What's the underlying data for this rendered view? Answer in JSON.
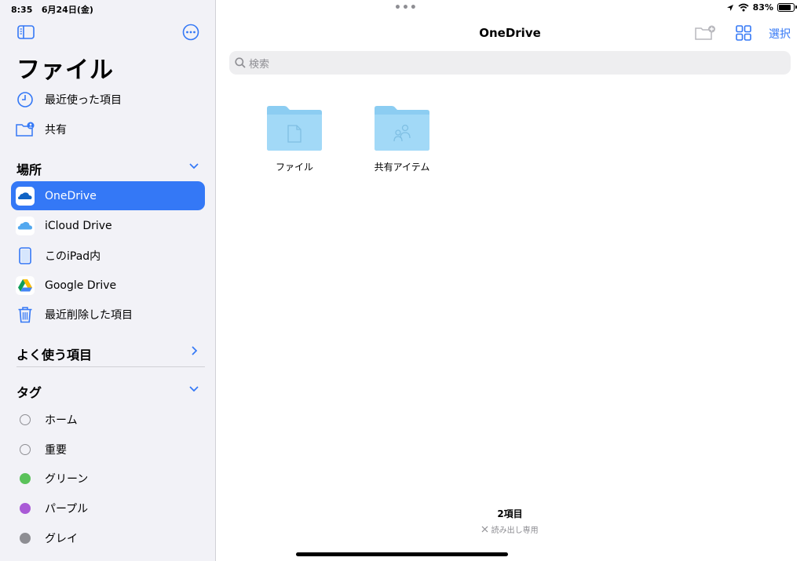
{
  "status": {
    "time": "8:35",
    "date": "6月24日(金)",
    "battery": "83%",
    "battery_level": 0.83
  },
  "sidebar": {
    "title": "ファイル",
    "top_items": [
      {
        "label": "最近使った項目",
        "icon": "clock-icon"
      },
      {
        "label": "共有",
        "icon": "shared-folder-icon"
      }
    ],
    "locations_header": "場所",
    "locations": [
      {
        "label": "OneDrive",
        "icon": "onedrive-icon",
        "selected": true
      },
      {
        "label": "iCloud Drive",
        "icon": "icloud-icon"
      },
      {
        "label": "このiPad内",
        "icon": "ipad-icon"
      },
      {
        "label": "Google Drive",
        "icon": "google-drive-icon"
      },
      {
        "label": "最近削除した項目",
        "icon": "trash-icon"
      }
    ],
    "favorites_header": "よく使う項目",
    "tags_header": "タグ",
    "tags": [
      {
        "label": "ホーム",
        "color": ""
      },
      {
        "label": "重要",
        "color": ""
      },
      {
        "label": "グリーン",
        "color": "#5ac25a"
      },
      {
        "label": "パープル",
        "color": "#a95ad6"
      },
      {
        "label": "グレイ",
        "color": "#8e8e93"
      }
    ]
  },
  "main": {
    "title": "OneDrive",
    "select_label": "選択",
    "search_placeholder": "検索",
    "folders": [
      {
        "label": "ファイル",
        "glyph": "document-icon"
      },
      {
        "label": "共有アイテム",
        "glyph": "people-icon"
      }
    ],
    "item_count": "2項目",
    "read_only": "読み出し専用"
  },
  "colors": {
    "accent": "#3478f6",
    "sidebar_bg": "#f2f2f7",
    "folder": "#8ccdf2"
  }
}
